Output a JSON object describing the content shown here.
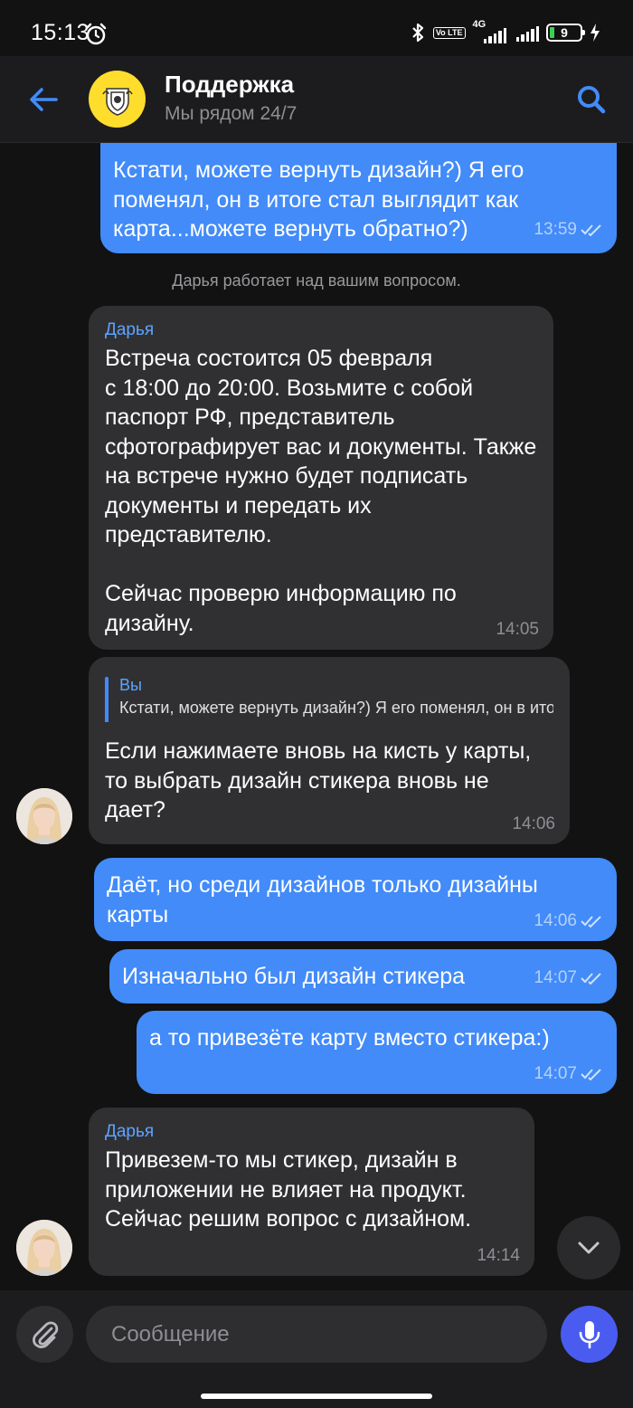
{
  "status_bar": {
    "time": "15:13",
    "network": "4G",
    "volte": "Vo LTE",
    "battery": "9"
  },
  "header": {
    "title": "Поддержка",
    "subtitle": "Мы рядом 24/7"
  },
  "chat": {
    "system_message": "Дарья  работает над вашим вопросом.",
    "messages": [
      {
        "direction": "out",
        "text": "Кстати, можете вернуть дизайн?)  Я его поменял, он в итоге стал выглядит как карта...можете вернуть обратно?)",
        "time": "13:59"
      },
      {
        "direction": "in",
        "author": "Дарья",
        "text": "Встреча состоится 05 февраля\nс 18:00 до 20:00. Возьмите с собой паспорт РФ, представитель сфотографирует вас и документы. Также на встрече нужно будет подписать документы и передать их представителю.\n\nСейчас проверю информацию по дизайну.",
        "time": "14:05"
      },
      {
        "direction": "in",
        "reply_author": "Вы",
        "reply_text": "Кстати, можете вернуть дизайн?) Я его поменял, он в итоге стал выглядит как карта...можете вернуть обратно?)",
        "text": "Если нажимаете вновь на кисть у карты, то выбрать дизайн стикера вновь не дает?",
        "time": "14:06"
      },
      {
        "direction": "out",
        "text": "Даёт, но среди дизайнов только дизайны карты",
        "time": "14:06"
      },
      {
        "direction": "out",
        "text": "Изначально был дизайн стикера",
        "time": "14:07"
      },
      {
        "direction": "out",
        "text": "а то привезёте карту вместо стикера:)",
        "time": "14:07"
      },
      {
        "direction": "in",
        "author": "Дарья",
        "text": "Привезем-то мы стикер, дизайн в приложении не влияет на продукт. Сейчас решим вопрос с дизайном.",
        "time": "14:14"
      }
    ]
  },
  "input": {
    "placeholder": "Сообщение"
  },
  "colors": {
    "accent": "#428bf9",
    "bubble_in": "#303033",
    "background": "#121212",
    "brand_yellow": "#ffdd2d",
    "mic": "#4a5cf0"
  }
}
